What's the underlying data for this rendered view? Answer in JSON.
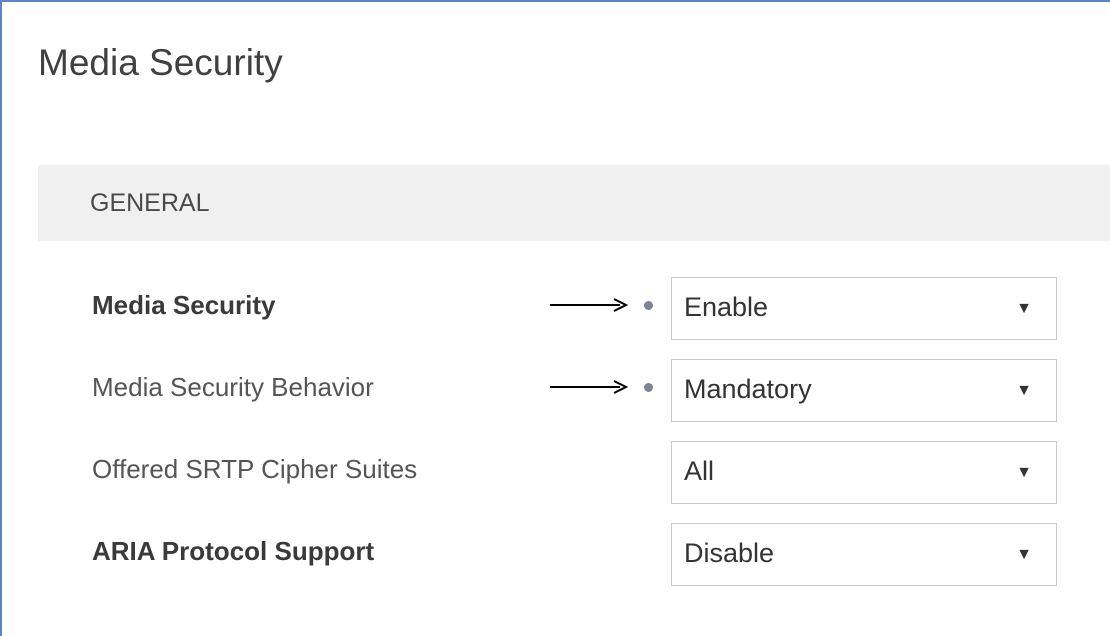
{
  "page": {
    "title": "Media Security"
  },
  "section": {
    "title": "GENERAL"
  },
  "fields": [
    {
      "label": "Media Security",
      "value": "Enable",
      "changed_indicator": true,
      "callout_arrow": true
    },
    {
      "label": "Media Security Behavior",
      "value": "Mandatory",
      "changed_indicator": true,
      "callout_arrow": true
    },
    {
      "label": "Offered SRTP Cipher Suites",
      "value": "All",
      "changed_indicator": false,
      "callout_arrow": false
    },
    {
      "label": "ARIA Protocol Support",
      "value": "Disable",
      "changed_indicator": false,
      "callout_arrow": false
    }
  ],
  "icons": {
    "dropdown": "caret-down-icon",
    "changed": "modified-dot-icon",
    "callout": "arrow-right-icon"
  },
  "colors": {
    "frame_border": "#5b86c2",
    "section_bg": "#f0f0f0",
    "changed_dot": "#7b8593"
  }
}
